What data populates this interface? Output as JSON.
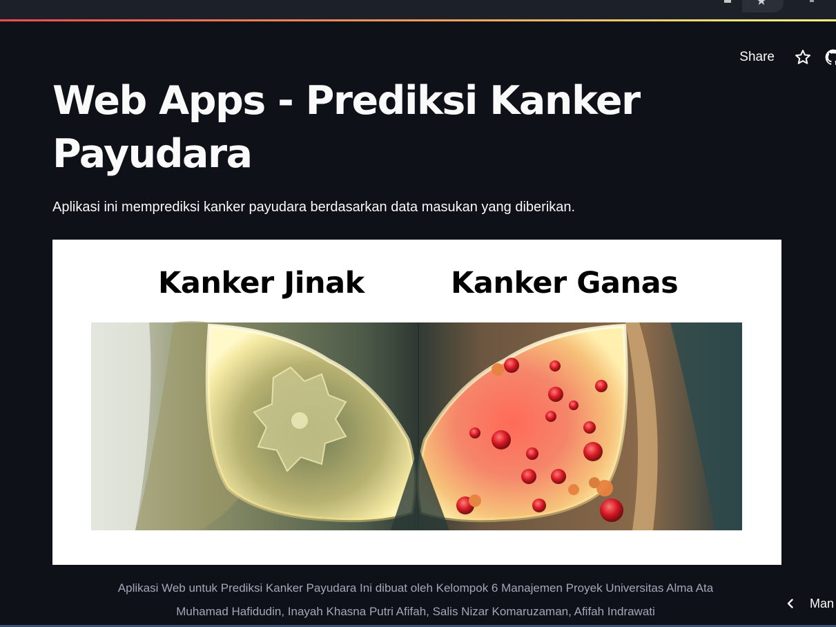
{
  "header": {
    "share_label": "Share",
    "icons": [
      "star-icon",
      "github-icon"
    ]
  },
  "main": {
    "title": "Web Apps - Prediksi Kanker Payudara",
    "description": "Aplikasi ini memprediksi kanker payudara berdasarkan data masukan yang diberikan.",
    "image": {
      "label_left": "Kanker Jinak",
      "label_right": "Kanker Ganas"
    },
    "credits": {
      "line1": "Aplikasi Web untuk Prediksi Kanker Payudara Ini dibuat oleh Kelompok 6 Manajemen Proyek Universitas Alma Ata",
      "line2": "Muhamad Hafidudin, Inayah Khasna Putri Afifah, Salis Nizar Komaruzaman, Afifah Indrawati"
    }
  },
  "sidebar": {
    "collapsed_label": "Man"
  },
  "colors": {
    "background": "#0e1117",
    "text": "#fafafa",
    "muted_text": "#a3a8b8",
    "accent_gradient_start": "#ff4b4b",
    "accent_gradient_end": "#fffd80"
  }
}
